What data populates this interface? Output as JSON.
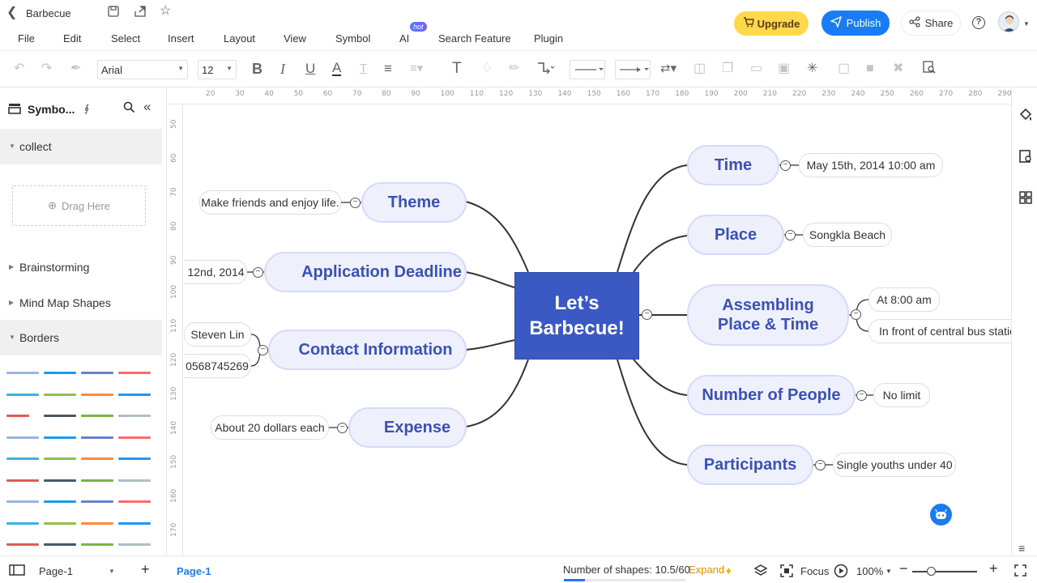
{
  "app": {
    "doc_title": "Barbecue",
    "menu": [
      "File",
      "Edit",
      "Select",
      "Insert",
      "Layout",
      "View",
      "Symbol",
      "AI",
      "Search Feature",
      "Plugin"
    ],
    "hot_badge": "hot",
    "upgrade_label": "Upgrade",
    "publish_label": "Publish",
    "share_label": "Share",
    "help_label": "?"
  },
  "toolbar": {
    "font": "Arial",
    "font_size": "12"
  },
  "left_panel": {
    "title": "Symbo...",
    "collect": "collect",
    "drag_here": "Drag Here",
    "sections": [
      "Brainstorming",
      "Mind Map Shapes",
      "Borders"
    ]
  },
  "rulers": {
    "h": [
      "20",
      "30",
      "40",
      "50",
      "60",
      "70",
      "80",
      "90",
      "100",
      "110",
      "120",
      "130",
      "140",
      "150",
      "160",
      "170",
      "180",
      "190",
      "200",
      "210",
      "220",
      "230",
      "240",
      "250",
      "260",
      "270",
      "280",
      "290"
    ],
    "v": [
      "50",
      "60",
      "70",
      "80",
      "90",
      "100",
      "110",
      "120",
      "130",
      "140",
      "150",
      "160",
      "170"
    ]
  },
  "mindmap": {
    "central": "Let’s Barbecue!",
    "left": {
      "theme": {
        "label": "Theme",
        "detail": "Make friends and enjoy life."
      },
      "deadline": {
        "label": "Application Deadline",
        "detail": "12nd, 2014"
      },
      "contact": {
        "label": "Contact Information",
        "details": [
          "Steven Lin",
          "0568745269"
        ]
      },
      "expense": {
        "label": "Expense",
        "detail": "About 20 dollars each"
      }
    },
    "right": {
      "time": {
        "label": "Time",
        "detail": "May 15th, 2014 10:00 am"
      },
      "place": {
        "label": "Place",
        "detail": "Songkla Beach"
      },
      "assembling": {
        "label_line1": "Assembling",
        "label_line2": "Place & Time",
        "details": [
          "At 8:00 am",
          "In front of central bus statio"
        ]
      },
      "people": {
        "label": "Number of People",
        "detail": "No limit"
      },
      "participants": {
        "label": "Participants",
        "detail": "Single youths under 40"
      }
    },
    "collapse_symbol": "−"
  },
  "status": {
    "page_selector": "Page-1",
    "page_tab": "Page-1",
    "add_page": "+",
    "shape_count": "Number of shapes: 10.5/60",
    "shape_fraction": 0.175,
    "expand": "Expand",
    "focus": "Focus",
    "zoom": "100%"
  },
  "colors": {
    "brand_blue": "#1a7cf5",
    "central_fill": "#3a59c3",
    "topic_text": "#3b51b5",
    "topic_fill": "#eef0fc",
    "upgrade_yellow": "#ffd84d",
    "expand_orange": "#f08c00"
  },
  "icons": [
    "back-icon",
    "save-icon",
    "export-icon",
    "star-icon",
    "undo-icon",
    "redo-icon",
    "format-painter-icon",
    "bold-icon",
    "italic-icon",
    "underline-icon",
    "font-color-icon",
    "text-icon",
    "fill-icon",
    "pen-icon",
    "connector-icon",
    "search-icon",
    "collapse-panel-icon",
    "paint-bucket-icon",
    "format-icon",
    "grid-icon",
    "layers-icon",
    "play-icon",
    "fullscreen-icon",
    "bot-icon"
  ]
}
